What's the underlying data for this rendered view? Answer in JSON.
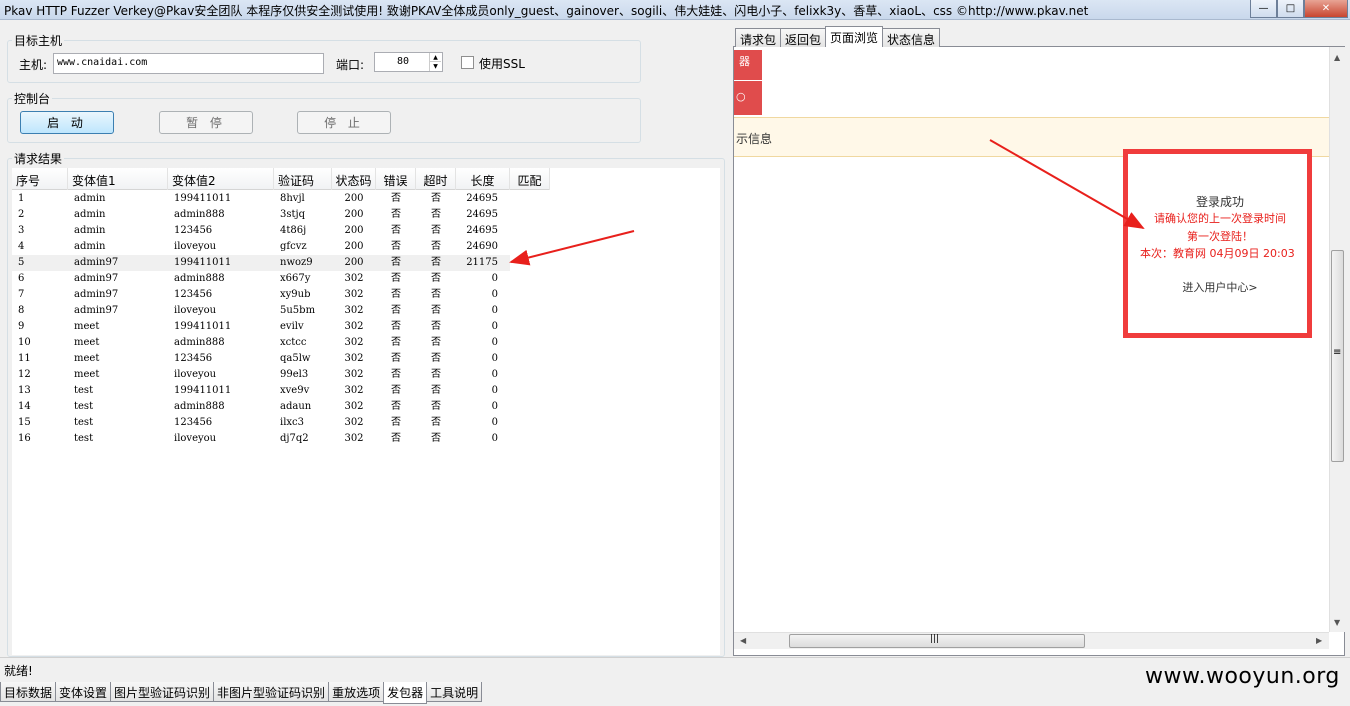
{
  "window": {
    "title": "Pkav HTTP Fuzzer   Verkey@Pkav安全团队  本程序仅供安全测试使用!  致谢PKAV全体成员only_guest、gainover、sogili、伟大娃娃、闪电小子、felixk3y、香草、xiaoL、css  ©http://www.pkav.net",
    "min_glyph": "—",
    "max_glyph": "□",
    "close_glyph": "✕"
  },
  "target": {
    "group_label": "目标主机",
    "host_label": "主机:",
    "host_value": "www.cnaidai.com",
    "port_label": "端口:",
    "port_value": "80",
    "ssl_label": "使用SSL"
  },
  "console": {
    "group_label": "控制台",
    "start_label": "启  动",
    "pause_label": "暂  停",
    "stop_label": "停  止"
  },
  "results": {
    "group_label": "请求结果",
    "columns": [
      "序号",
      "变体值1",
      "变体值2",
      "验证码",
      "状态码",
      "错误",
      "超时",
      "长度",
      "匹配"
    ],
    "rows": [
      [
        "1",
        "admin",
        "199411011",
        "8hvjl",
        "200",
        "否",
        "否",
        "24695"
      ],
      [
        "2",
        "admin",
        "admin888",
        "3stjq",
        "200",
        "否",
        "否",
        "24695"
      ],
      [
        "3",
        "admin",
        "123456",
        "4t86j",
        "200",
        "否",
        "否",
        "24695"
      ],
      [
        "4",
        "admin",
        "iloveyou",
        "gfcvz",
        "200",
        "否",
        "否",
        "24690"
      ],
      [
        "5",
        "admin97",
        "199411011",
        "nwoz9",
        "200",
        "否",
        "否",
        "21175"
      ],
      [
        "6",
        "admin97",
        "admin888",
        "x667y",
        "302",
        "否",
        "否",
        "0"
      ],
      [
        "7",
        "admin97",
        "123456",
        "xy9ub",
        "302",
        "否",
        "否",
        "0"
      ],
      [
        "8",
        "admin97",
        "iloveyou",
        "5u5bm",
        "302",
        "否",
        "否",
        "0"
      ],
      [
        "9",
        "meet",
        "199411011",
        "evilv",
        "302",
        "否",
        "否",
        "0"
      ],
      [
        "10",
        "meet",
        "admin888",
        "xctcc",
        "302",
        "否",
        "否",
        "0"
      ],
      [
        "11",
        "meet",
        "123456",
        "qa5lw",
        "302",
        "否",
        "否",
        "0"
      ],
      [
        "12",
        "meet",
        "iloveyou",
        "99el3",
        "302",
        "否",
        "否",
        "0"
      ],
      [
        "13",
        "test",
        "199411011",
        "xve9v",
        "302",
        "否",
        "否",
        "0"
      ],
      [
        "14",
        "test",
        "admin888",
        "adaun",
        "302",
        "否",
        "否",
        "0"
      ],
      [
        "15",
        "test",
        "123456",
        "ilxc3",
        "302",
        "否",
        "否",
        "0"
      ],
      [
        "16",
        "test",
        "iloveyou",
        "dj7q2",
        "302",
        "否",
        "否",
        "0"
      ]
    ]
  },
  "right_tabs": [
    "请求包",
    "返回包",
    "页面浏览",
    "状态信息"
  ],
  "browser": {
    "red_block_1": "器",
    "red_block_2": "○",
    "info_strip": "示信息",
    "login": {
      "title": "登录成功",
      "line1": "请确认您的上一次登录时间",
      "line2": "第一次登陆！",
      "line3": "本次：教育网 04月09日 20:03",
      "link": "进入用户中心>"
    },
    "vscroll_grip": "≡",
    "hscroll_grip": "|||"
  },
  "status": {
    "text": "就绪!"
  },
  "bottom_tabs": [
    "目标数据",
    "变体设置",
    "图片型验证码识别",
    "非图片型验证码识别",
    "重放选项",
    "发包器",
    "工具说明"
  ],
  "watermark": "www.wooyun.org",
  "colors": {
    "annotation_red": "#f03c3c",
    "arrow_red": "#e8201c"
  }
}
